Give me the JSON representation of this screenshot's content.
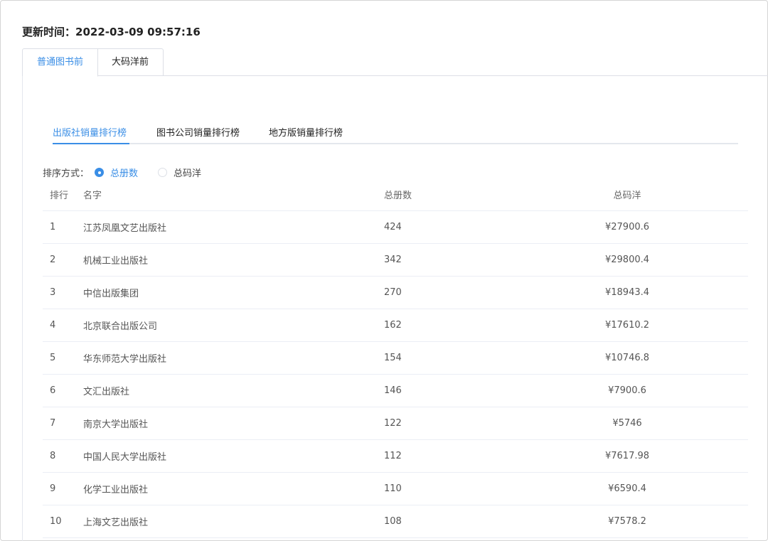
{
  "update": {
    "label": "更新时间：",
    "value": "2022-03-09 09:57:16"
  },
  "main_tabs": [
    {
      "label": "普通图书前",
      "active": true
    },
    {
      "label": "大码洋前",
      "active": false
    }
  ],
  "sub_tabs": [
    {
      "label": "出版社销量排行榜",
      "active": true
    },
    {
      "label": "图书公司销量排行榜",
      "active": false
    },
    {
      "label": "地方版销量排行榜",
      "active": false
    }
  ],
  "sort": {
    "label": "排序方式：",
    "options": [
      {
        "label": "总册数",
        "selected": true
      },
      {
        "label": "总码洋",
        "selected": false
      }
    ]
  },
  "table": {
    "headers": [
      "排行",
      "名字",
      "总册数",
      "总码洋"
    ],
    "rows": [
      {
        "rank": "1",
        "name": "江苏凤凰文艺出版社",
        "count": "424",
        "amount": "¥27900.6"
      },
      {
        "rank": "2",
        "name": "机械工业出版社",
        "count": "342",
        "amount": "¥29800.4"
      },
      {
        "rank": "3",
        "name": "中信出版集团",
        "count": "270",
        "amount": "¥18943.4"
      },
      {
        "rank": "4",
        "name": "北京联合出版公司",
        "count": "162",
        "amount": "¥17610.2"
      },
      {
        "rank": "5",
        "name": "华东师范大学出版社",
        "count": "154",
        "amount": "¥10746.8"
      },
      {
        "rank": "6",
        "name": "文汇出版社",
        "count": "146",
        "amount": "¥7900.6"
      },
      {
        "rank": "7",
        "name": "南京大学出版社",
        "count": "122",
        "amount": "¥5746"
      },
      {
        "rank": "8",
        "name": "中国人民大学出版社",
        "count": "112",
        "amount": "¥7617.98"
      },
      {
        "rank": "9",
        "name": "化学工业出版社",
        "count": "110",
        "amount": "¥6590.4"
      },
      {
        "rank": "10",
        "name": "上海文艺出版社",
        "count": "108",
        "amount": "¥7578.2"
      }
    ]
  },
  "colors": {
    "accent": "#3a8ee6",
    "border": "#dcdfe6"
  }
}
